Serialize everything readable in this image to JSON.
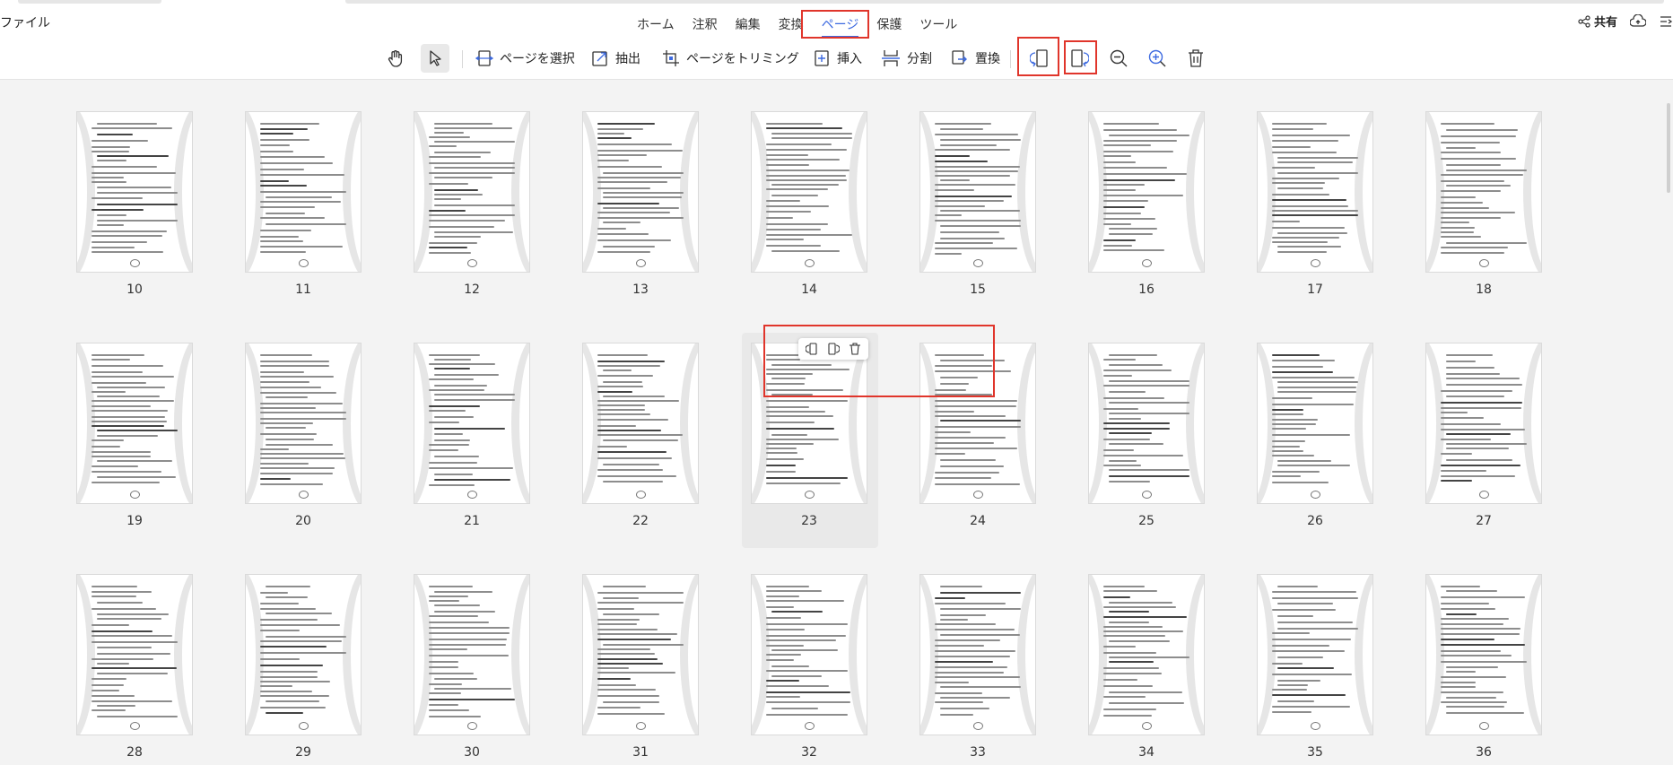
{
  "app": {
    "file_menu": "ファイル",
    "tabs": [
      {
        "label": "ホーム",
        "active": false
      },
      {
        "label": "注釈",
        "active": false
      },
      {
        "label": "編集",
        "active": false
      },
      {
        "label": "変換",
        "active": false
      },
      {
        "label": "ページ",
        "active": true
      },
      {
        "label": "保護",
        "active": false
      },
      {
        "label": "ツール",
        "active": false
      }
    ],
    "share_label": "共有",
    "accent_color": "#3d6ae0",
    "highlight_color": "#e0352b"
  },
  "toolbar": {
    "hand_tool": "hand-icon",
    "select_tool": "cursor-icon",
    "select_pages": "ページを選択",
    "extract": "抽出",
    "trim_pages": "ページをトリミング",
    "insert": "挿入",
    "split": "分割",
    "replace": "置換",
    "rotate_left": "rotate-left-icon",
    "rotate_right": "rotate-right-icon",
    "zoom_out": "zoom-out-icon",
    "zoom_in": "zoom-in-icon",
    "delete": "trash-icon"
  },
  "pages": {
    "rows": [
      [
        "10",
        "11",
        "12",
        "13",
        "14",
        "15",
        "16",
        "17",
        "18"
      ],
      [
        "19",
        "20",
        "21",
        "22",
        "23",
        "24",
        "25",
        "26",
        "27"
      ],
      [
        "28",
        "29",
        "30",
        "31",
        "32",
        "33",
        "34",
        "35",
        "36"
      ]
    ],
    "hovered_page": "23"
  }
}
